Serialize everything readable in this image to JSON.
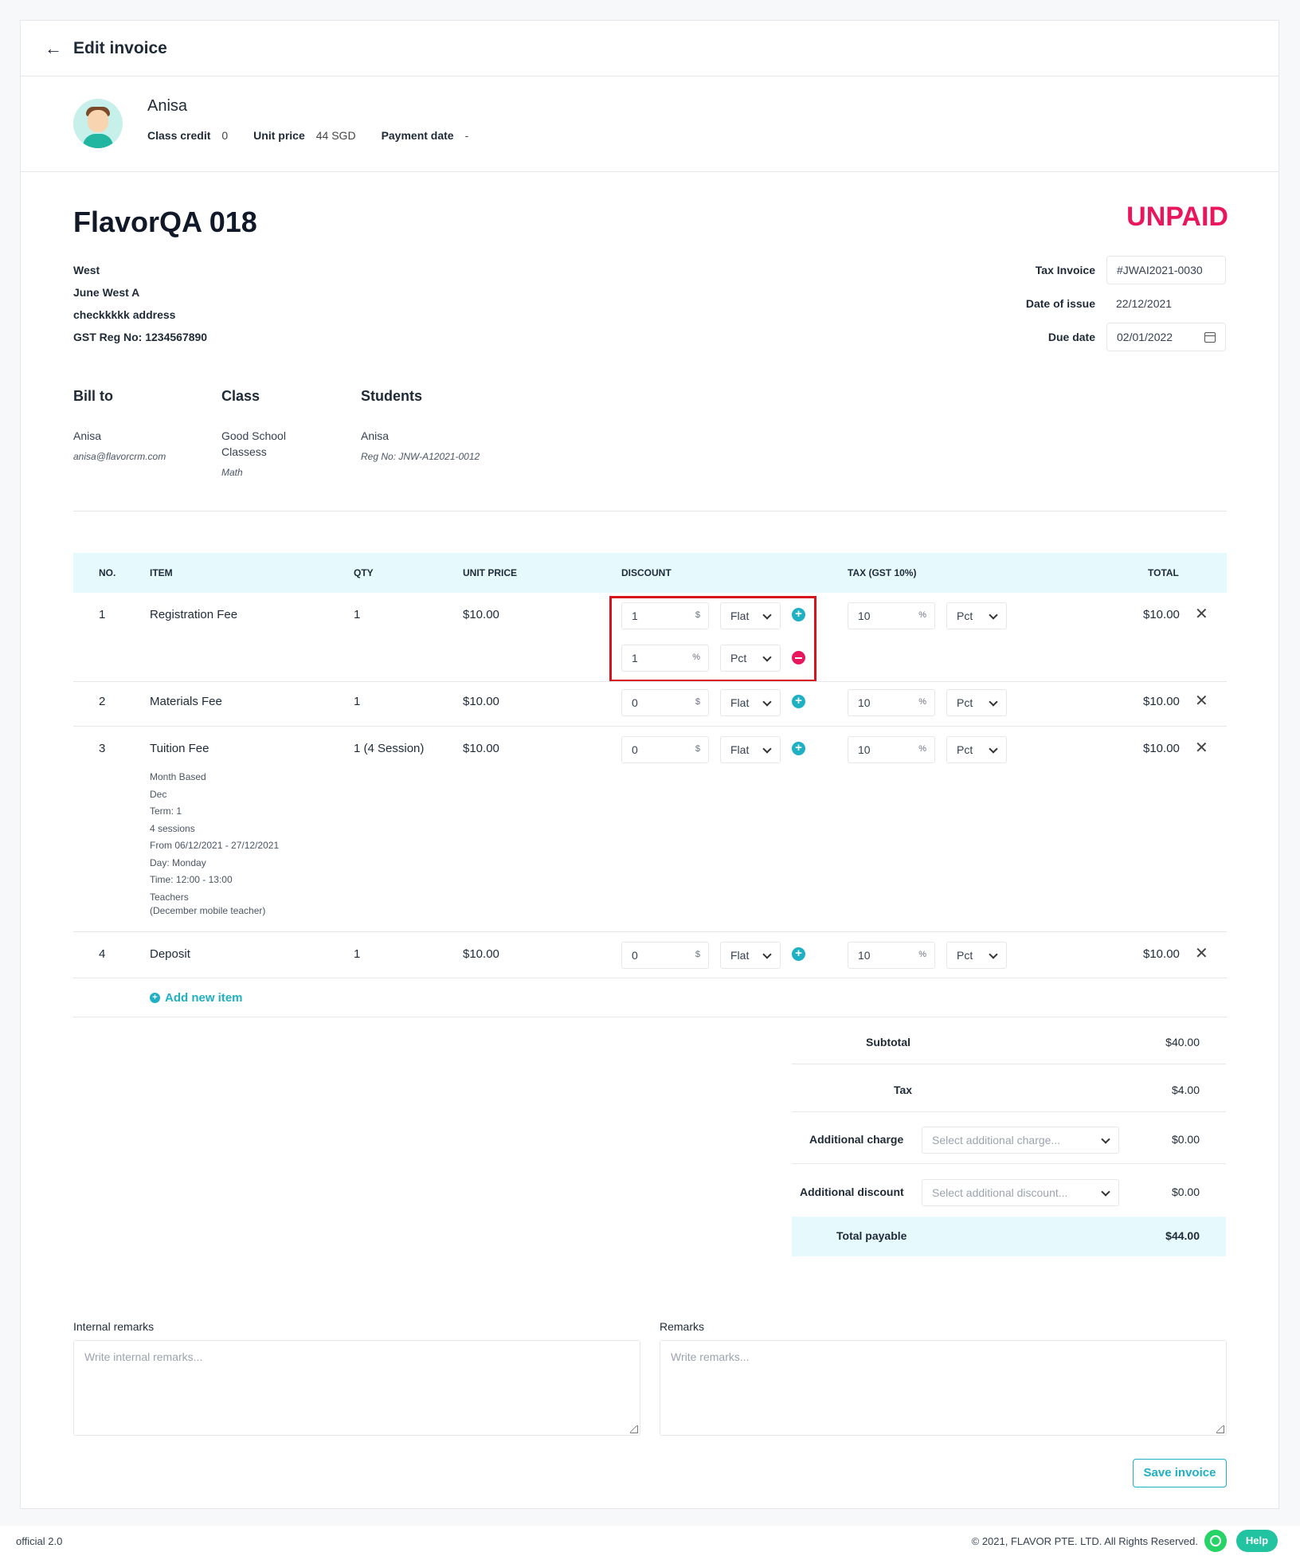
{
  "header": {
    "title": "Edit invoice"
  },
  "profile": {
    "name": "Anisa",
    "class_credit_label": "Class credit",
    "class_credit_value": "0",
    "unit_price_label": "Unit price",
    "unit_price_value": "44 SGD",
    "payment_date_label": "Payment date",
    "payment_date_value": "-"
  },
  "invoice": {
    "title": "FlavorQA 018",
    "status": "UNPAID",
    "address": [
      "West",
      "June West A",
      "checkkkkk address",
      "GST Reg No: 1234567890"
    ],
    "tax_invoice_label": "Tax Invoice",
    "tax_invoice_value": "#JWAI2021-0030",
    "date_of_issue_label": "Date of issue",
    "date_of_issue_value": "22/12/2021",
    "due_date_label": "Due date",
    "due_date_value": "02/01/2022"
  },
  "bill": {
    "bill_to_label": "Bill to",
    "bill_to_name": "Anisa",
    "bill_to_email": "anisa@flavorcrm.com",
    "class_label": "Class",
    "class_line1": "Good School",
    "class_line2": "Classess",
    "class_subject": "Math",
    "students_label": "Students",
    "student_name": "Anisa",
    "student_reg": "Reg No: JNW-A12021-0012"
  },
  "table": {
    "headers": {
      "no": "NO.",
      "item": "ITEM",
      "qty": "QTY",
      "unit_price": "UNIT PRICE",
      "discount": "DISCOUNT",
      "tax": "TAX (GST 10%)",
      "total": "TOTAL"
    },
    "rows": [
      {
        "no": "1",
        "item": "Registration Fee",
        "qty": "1",
        "unit_price": "$10.00",
        "discount_value": "1",
        "discount_unit": "$",
        "discount_type": "Flat",
        "discount2_value": "1",
        "discount2_unit": "%",
        "discount2_type": "Pct",
        "tax_value": "10",
        "tax_unit": "%",
        "tax_type": "Pct",
        "total": "$10.00"
      },
      {
        "no": "2",
        "item": "Materials Fee",
        "qty": "1",
        "unit_price": "$10.00",
        "discount_value": "0",
        "discount_unit": "$",
        "discount_type": "Flat",
        "tax_value": "10",
        "tax_unit": "%",
        "tax_type": "Pct",
        "total": "$10.00"
      },
      {
        "no": "3",
        "item": "Tuition Fee",
        "qty": "1 (4 Session)",
        "unit_price": "$10.00",
        "discount_value": "0",
        "discount_unit": "$",
        "discount_type": "Flat",
        "tax_value": "10",
        "tax_unit": "%",
        "tax_type": "Pct",
        "total": "$10.00",
        "details": [
          "Month Based",
          "Dec",
          "Term: 1",
          "4 sessions",
          "From 06/12/2021 - 27/12/2021",
          "Day: Monday",
          "Time: 12:00 - 13:00",
          "Teachers",
          "(December mobile teacher)"
        ]
      },
      {
        "no": "4",
        "item": "Deposit",
        "qty": "1",
        "unit_price": "$10.00",
        "discount_value": "0",
        "discount_unit": "$",
        "discount_type": "Flat",
        "tax_value": "10",
        "tax_unit": "%",
        "tax_type": "Pct",
        "total": "$10.00"
      }
    ],
    "add_new_item": "Add new item"
  },
  "totals": {
    "subtotal_label": "Subtotal",
    "subtotal_value": "$40.00",
    "tax_label": "Tax",
    "tax_value": "$4.00",
    "additional_charge_label": "Additional charge",
    "additional_charge_placeholder": "Select additional charge...",
    "additional_charge_value": "$0.00",
    "additional_discount_label": "Additional discount",
    "additional_discount_placeholder": "Select additional discount...",
    "additional_discount_value": "$0.00",
    "total_label": "Total payable",
    "total_value": "$44.00"
  },
  "remarks": {
    "internal_label": "Internal remarks",
    "internal_placeholder": "Write internal remarks...",
    "remarks_label": "Remarks",
    "remarks_placeholder": "Write remarks..."
  },
  "actions": {
    "save_label": "Save invoice"
  },
  "footer": {
    "version": "official 2.0",
    "copyright": "© 2021, FLAVOR PTE. LTD. All Rights Reserved.",
    "help_label": "Help"
  },
  "colors": {
    "accent": "#1fb0c4",
    "unpaid": "#e8175d",
    "header_bg": "#e6f9fd",
    "highlight": "#d7141e"
  }
}
